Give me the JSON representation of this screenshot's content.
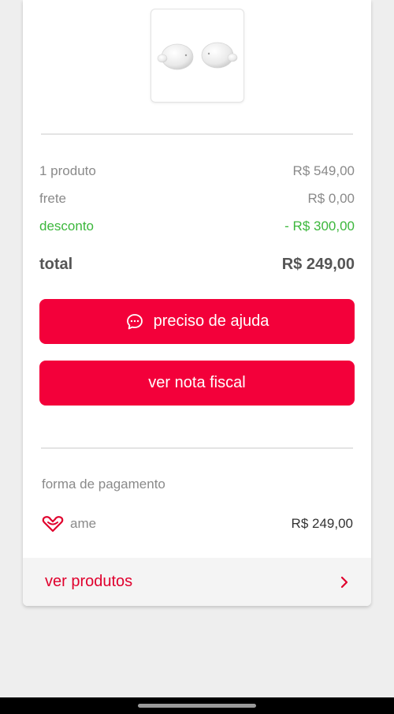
{
  "order": {
    "product_image_icon": "earbuds-image",
    "summary": {
      "products_label": "1 produto",
      "products_value": "R$ 549,00",
      "shipping_label": "frete",
      "shipping_value": "R$ 0,00",
      "discount_label": "desconto",
      "discount_value": "- R$ 300,00",
      "total_label": "total",
      "total_value": "R$ 249,00"
    },
    "actions": {
      "help_label": "preciso de ajuda",
      "help_icon": "chat-bubble-icon",
      "invoice_label": "ver nota fiscal"
    },
    "payment": {
      "section_label": "forma de pagamento",
      "method_icon": "ame-heart-icon",
      "method_label": "ame",
      "amount": "R$ 249,00"
    },
    "products_link": {
      "label": "ver produtos",
      "icon": "chevron-right-icon"
    }
  },
  "colors": {
    "accent": "#f3003a",
    "link": "#e0002d",
    "discount": "#3cb73c"
  }
}
